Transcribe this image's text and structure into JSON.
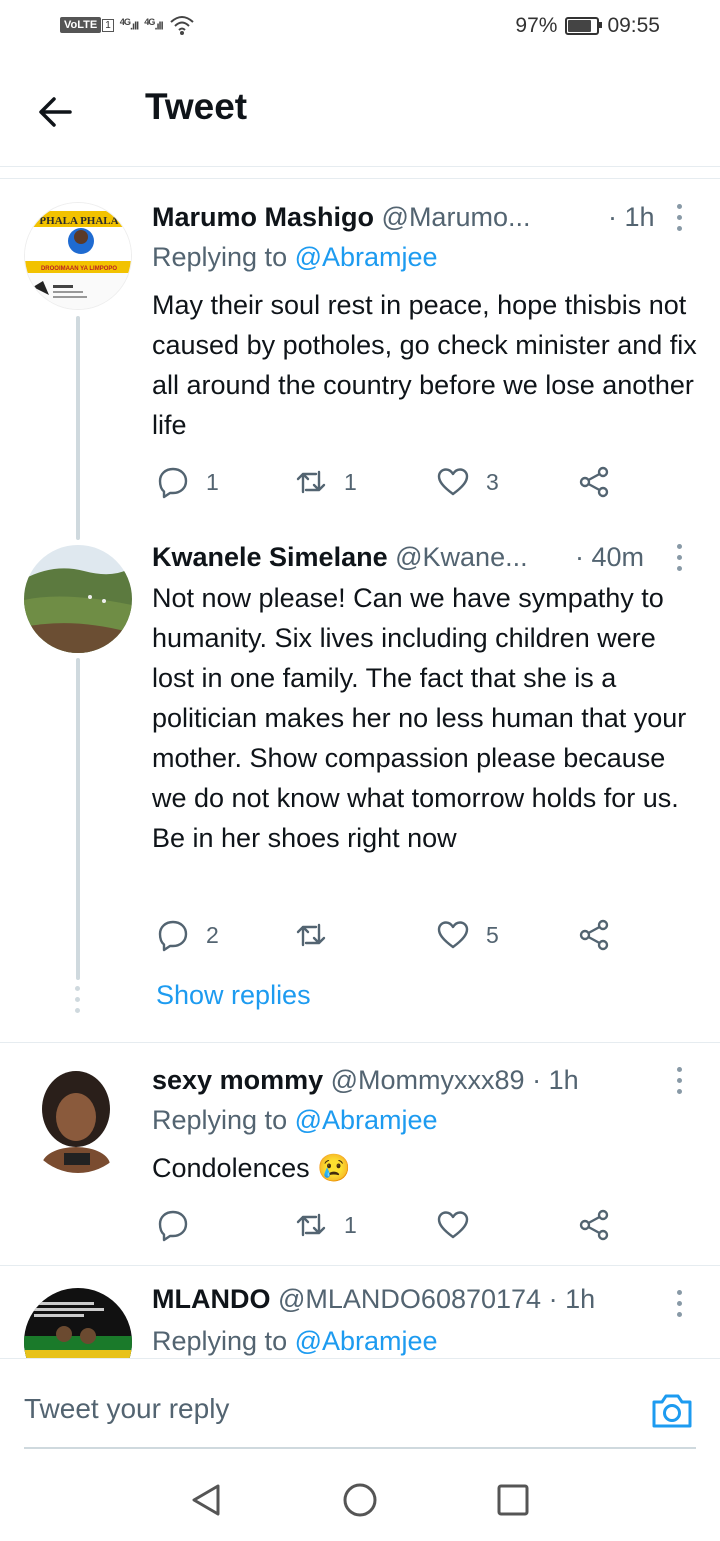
{
  "status_bar": {
    "network_label": "VoLTE",
    "network_sub": "1",
    "signal1": "4G",
    "signal2": "4G",
    "battery_pct": "97%",
    "battery_level": 0.97,
    "time": "09:55"
  },
  "header": {
    "title": "Tweet"
  },
  "tweets": [
    {
      "name": "Marumo Mashigo",
      "handle": "@Marumo...",
      "time": "· 1h",
      "replying_prefix": "Replying to",
      "replying_to": "@Abramjee",
      "text": "May their soul rest in peace, hope thisbis not caused by potholes, go check minister and fix all around the country before we lose another life",
      "replies": "1",
      "retweets": "1",
      "likes": "3",
      "avatar_banner_text": "PHALA PHALA",
      "avatar_footer_text": "DROOIMAAN YA LIMPOPO"
    },
    {
      "name": "Kwanele Simelane",
      "handle": "@Kwane...",
      "time": "· 40m",
      "text": "Not now please! Can we have sympathy to humanity. Six lives including children were lost in one family. The fact that she is a politician makes her no less human that your mother. Show compassion please because we do not know what tomorrow holds for us. Be in her shoes right now",
      "replies": "2",
      "retweets": "",
      "likes": "5"
    },
    {
      "name": "sexy mommy",
      "handle": "@Mommyxxx89",
      "time": "· 1h",
      "replying_prefix": "Replying to",
      "replying_to": "@Abramjee",
      "text": "Condolences",
      "emoji": "😢",
      "replies": "",
      "retweets": "1",
      "likes": ""
    },
    {
      "name": "MLANDO",
      "handle": "@MLANDO60870174",
      "time": "· 1h",
      "replying_prefix": "Replying to",
      "replying_to": "@Abramjee"
    }
  ],
  "show_replies": "Show replies",
  "reply_bar": {
    "placeholder": "Tweet your reply"
  },
  "colors": {
    "accent": "#1d9bf0",
    "muted": "#536471",
    "text": "#0f1419"
  }
}
